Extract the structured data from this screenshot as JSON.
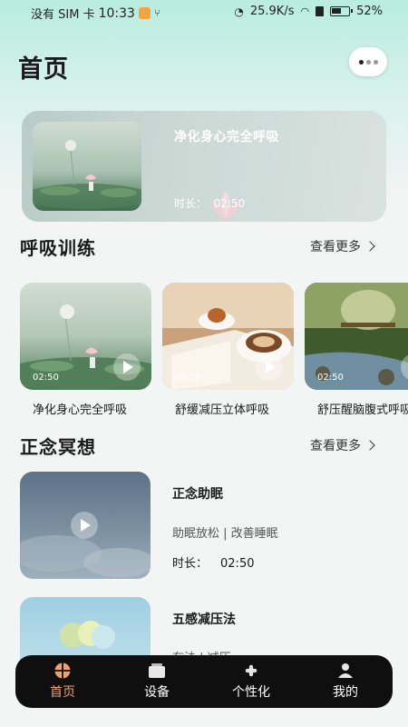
{
  "status_bar": {
    "carrier": "没有 SIM 卡",
    "time": "10:33",
    "usb_icon": "usb-icon",
    "network_speed": "25.9K/s",
    "battery_percent": "52%"
  },
  "header": {
    "title": "首页",
    "more_icon": "more-dots-icon"
  },
  "hero": {
    "title": "净化身心完全呼吸",
    "duration_label": "时长：",
    "duration": "02:50"
  },
  "breathing_section": {
    "title": "呼吸训练",
    "see_more": "查看更多",
    "items": [
      {
        "name": "净化身心完全呼吸",
        "duration": "02:50"
      },
      {
        "name": "舒缓减压立体呼吸",
        "duration": "02:50"
      },
      {
        "name": "舒压醒脑腹式呼吸",
        "duration": "02:50"
      }
    ]
  },
  "meditation_section": {
    "title": "正念冥想",
    "see_more": "查看更多",
    "items": [
      {
        "title": "正念助眠",
        "subtitle": "助眠放松 | 改善睡眠",
        "duration_label": "时长：",
        "duration": "02:50"
      },
      {
        "title": "五感减压法",
        "subtitle": "有法 | 减压",
        "duration_label": "",
        "duration": ""
      }
    ]
  },
  "bottom_nav": {
    "items": [
      {
        "label": "首页",
        "icon": "home-icon",
        "active": true
      },
      {
        "label": "设备",
        "icon": "device-icon",
        "active": false
      },
      {
        "label": "个性化",
        "icon": "personalize-icon",
        "active": false
      },
      {
        "label": "我的",
        "icon": "profile-icon",
        "active": false
      }
    ]
  },
  "colors": {
    "accent": "#f0a06c",
    "nav_background": "#0f0f0f",
    "header_gradient_top": "#b9ecdf"
  }
}
